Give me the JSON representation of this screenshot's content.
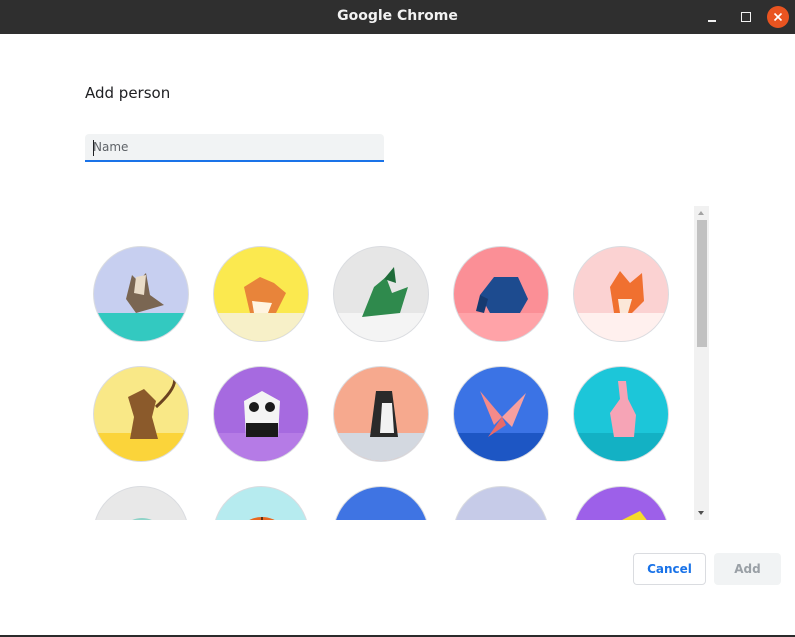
{
  "window": {
    "title": "Google Chrome",
    "controls": {
      "close_color": "#e95420"
    }
  },
  "dialog": {
    "heading": "Add person",
    "name_input": {
      "value": "",
      "placeholder": "Name"
    },
    "avatars": [
      {
        "name": "cat",
        "icon": "origami-cat-icon",
        "background": "#c7cff0",
        "accent": "#33c9c0"
      },
      {
        "name": "corgi",
        "icon": "origami-corgi-icon",
        "background": "#fbe94f",
        "accent": "#f7f0c8"
      },
      {
        "name": "dragon",
        "icon": "origami-dragon-icon",
        "background": "#e6e6e6",
        "accent": "#f4f4f4"
      },
      {
        "name": "elephant",
        "icon": "origami-elephant-icon",
        "background": "#fb8f96",
        "accent": "#ffa3a8"
      },
      {
        "name": "fox",
        "icon": "origami-fox-icon",
        "background": "#fbd2d2",
        "accent": "#fff0ee"
      },
      {
        "name": "monkey",
        "icon": "origami-monkey-icon",
        "background": "#f9e887",
        "accent": "#fbd43a"
      },
      {
        "name": "panda",
        "icon": "origami-panda-icon",
        "background": "#a66ae0",
        "accent": "#b57be6"
      },
      {
        "name": "penguin",
        "icon": "origami-penguin-icon",
        "background": "#f6a98e",
        "accent": "#d3d8e0"
      },
      {
        "name": "butterfly",
        "icon": "origami-butterfly-icon",
        "background": "#3b73e5",
        "accent": "#1d56c4"
      },
      {
        "name": "rabbit",
        "icon": "origami-rabbit-icon",
        "background": "#1cc6d9",
        "accent": "#13b1c4"
      },
      {
        "name": "unicorn",
        "icon": "origami-unicorn-icon",
        "background": "#e8e8e8",
        "accent": "#c5a8e3"
      },
      {
        "name": "basketball",
        "icon": "basketball-icon",
        "background": "#b6ebef",
        "accent": "#e8671f"
      },
      {
        "name": "bike",
        "icon": "bicycle-icon",
        "background": "#3f74e3",
        "accent": "#f05a3b"
      },
      {
        "name": "bird",
        "icon": "red-bird-icon",
        "background": "#c6cbe8",
        "accent": "#e7283b"
      },
      {
        "name": "cheese",
        "icon": "cheese-icon",
        "background": "#9d60e9",
        "accent": "#f6dc2a"
      }
    ]
  },
  "buttons": {
    "cancel": "Cancel",
    "add": "Add"
  }
}
